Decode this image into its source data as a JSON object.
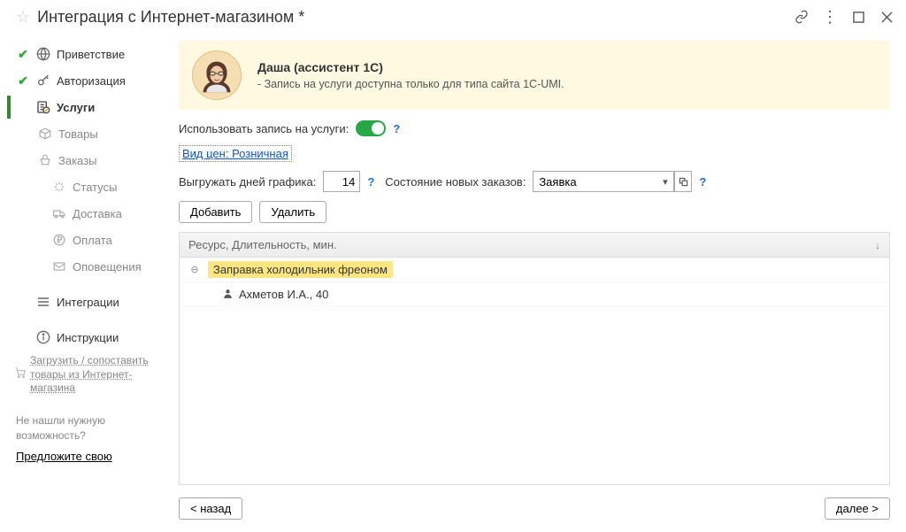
{
  "window": {
    "title": "Интеграция с Интернет-магазином *"
  },
  "sidebar": {
    "items": [
      {
        "label": "Приветствие"
      },
      {
        "label": "Авторизация"
      },
      {
        "label": "Услуги"
      },
      {
        "label": "Товары"
      },
      {
        "label": "Заказы"
      },
      {
        "label": "Статусы"
      },
      {
        "label": "Доставка"
      },
      {
        "label": "Оплата"
      },
      {
        "label": "Оповещения"
      }
    ],
    "integrations": "Интеграции",
    "instructions": "Инструкции",
    "load_match": "Загрузить / сопоставить товары из Интернет-магазина",
    "footer_q": "Не нашли нужную возможность?",
    "footer_link": "Предложите свою"
  },
  "banner": {
    "title": "Даша (ассистент 1С)",
    "line": "- Запись на услуги доступна только для типа сайта 1С-UMI."
  },
  "form": {
    "use_booking": "Использовать запись на услуги:",
    "price_link": "Вид цен: Розничная",
    "days_label": "Выгружать дней графика:",
    "days_value": "14",
    "status_label": "Состояние новых заказов:",
    "status_value": "Заявка",
    "add_btn": "Добавить",
    "del_btn": "Удалить"
  },
  "table": {
    "header": "Ресурс, Длительность, мин.",
    "group": "Заправка холодильник фреоном",
    "row1": "Ахметов И.А., 40"
  },
  "nav": {
    "back": "< назад",
    "next": "далее >"
  }
}
